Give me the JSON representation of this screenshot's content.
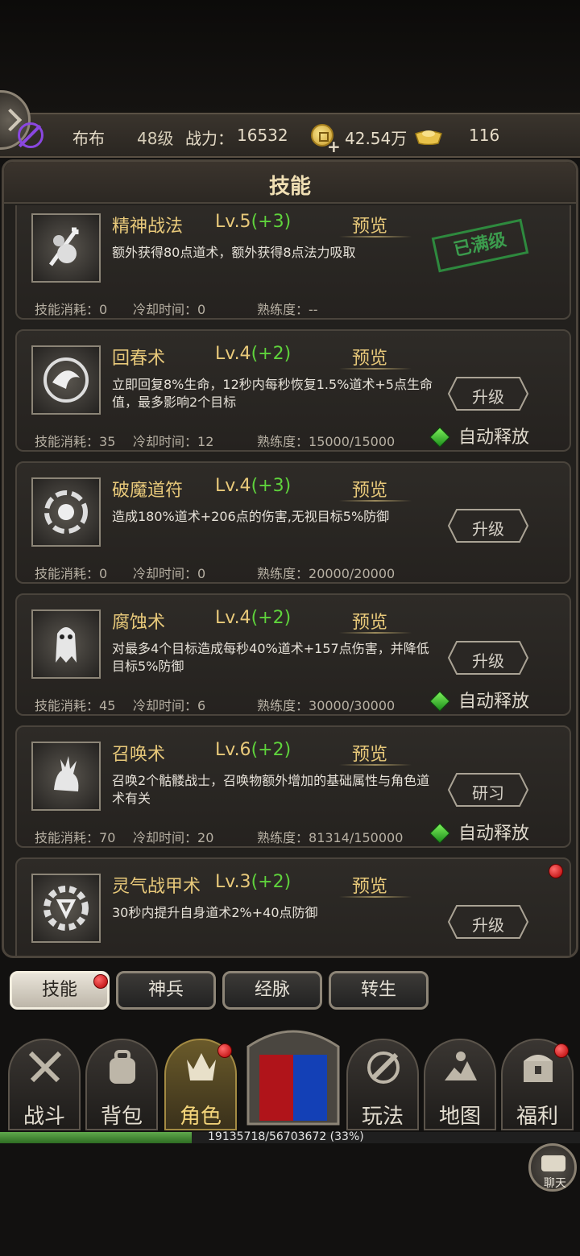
{
  "status": {
    "name": "布布",
    "level": "48级",
    "power_label": "战力：",
    "power_value": "16532",
    "coins": "42.54万",
    "ingots": "116"
  },
  "panel": {
    "title": "技能"
  },
  "labels": {
    "preview": "预览",
    "cost": "技能消耗：",
    "cooldown": "冷却时间：",
    "proficiency": "熟练度：",
    "auto": "自动释放",
    "maxed": "已满级"
  },
  "skills": [
    {
      "name": "精神战法",
      "lv": "Lv.5",
      "plus": "(+3)",
      "desc": "额外获得80点道术，额外获得8点法力吸取",
      "cost": "0",
      "cd": "0",
      "prof": "--",
      "action": ""
    },
    {
      "name": "回春术",
      "lv": "Lv.4",
      "plus": "(+2)",
      "desc": "立即回复8%生命，12秒内每秒恢复1.5%道术+5点生命值，最多影响2个目标",
      "cost": "35",
      "cd": "12",
      "prof": "15000/15000",
      "action": "升级"
    },
    {
      "name": "破魔道符",
      "lv": "Lv.4",
      "plus": "(+3)",
      "desc": "造成180%道术+206点的伤害,无视目标5%防御",
      "cost": "0",
      "cd": "0",
      "prof": "20000/20000",
      "action": "升级"
    },
    {
      "name": "腐蚀术",
      "lv": "Lv.4",
      "plus": "(+2)",
      "desc": "对最多4个目标造成每秒40%道术+157点伤害，并降低目标5%防御",
      "cost": "45",
      "cd": "6",
      "prof": "30000/30000",
      "action": "升级"
    },
    {
      "name": "召唤术",
      "lv": "Lv.6",
      "plus": "(+2)",
      "desc": "召唤2个骷髅战士，召唤物额外增加的基础属性与角色道术有关",
      "cost": "70",
      "cd": "20",
      "prof": "81314/150000",
      "action": "研习"
    },
    {
      "name": "灵气战甲术",
      "lv": "Lv.3",
      "plus": "(+2)",
      "desc": "30秒内提升自身道术2%+40点防御",
      "action": "升级"
    }
  ],
  "tabs": [
    "技能",
    "神兵",
    "经脉",
    "转生"
  ],
  "nav": [
    "战斗",
    "背包",
    "角色",
    "玩法",
    "地图",
    "福利"
  ],
  "xp": {
    "text": "19135718/56703672 (33%)",
    "fraction": 0.33
  },
  "chat": {
    "label": "聊天"
  },
  "colors": {
    "gold": "#e8c97a",
    "green": "#5fd33c",
    "panel": "#22201d"
  }
}
